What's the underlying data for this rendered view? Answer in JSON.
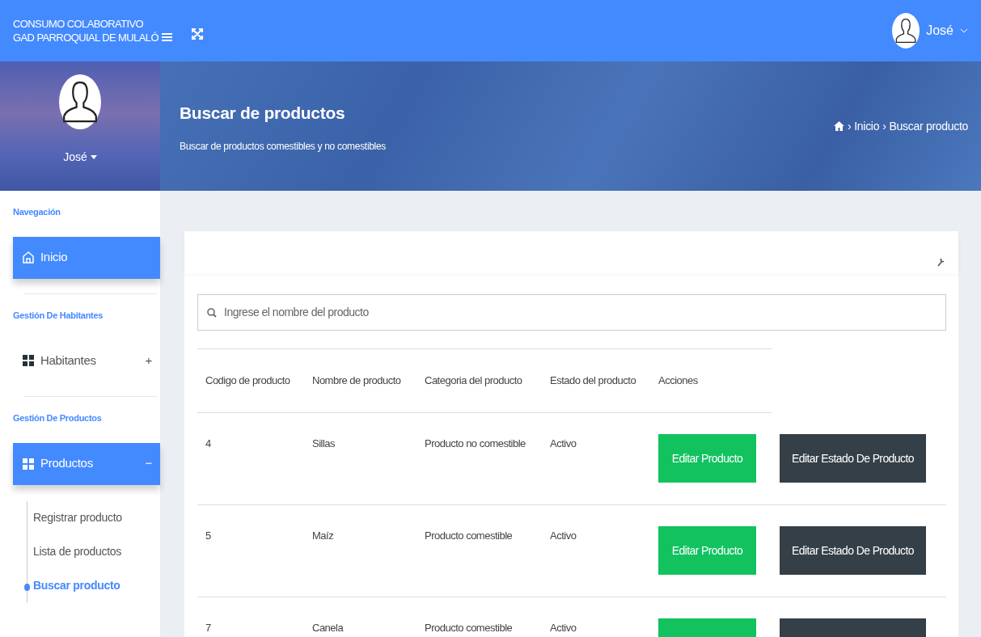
{
  "topbar": {
    "brand_lines": [
      "CONSUMO COLABORATIVO",
      "GAD PARROQUIAL DE MULALÓ"
    ],
    "user": "José"
  },
  "profile": {
    "name": "José"
  },
  "sidebar": {
    "sections": [
      {
        "title": "Navegación",
        "items": [
          {
            "label": "Inicio",
            "kind": "home",
            "selected": true
          }
        ]
      },
      {
        "title": "Gestión De Habitantes",
        "items": [
          {
            "label": "Habitantes",
            "kind": "group",
            "selected": false,
            "expander": "+"
          }
        ]
      },
      {
        "title": "Gestión De Productos",
        "items": [
          {
            "label": "Productos",
            "kind": "group",
            "selected": true,
            "expander": "−",
            "children": [
              {
                "label": "Registrar producto",
                "selected": false
              },
              {
                "label": "Lista de productos",
                "selected": false
              },
              {
                "label": "Buscar producto",
                "selected": true
              }
            ]
          }
        ]
      }
    ]
  },
  "header": {
    "title": "Buscar de productos",
    "subtitle": "Buscar de productos comestibles y no comestibles",
    "breadcrumb": [
      {
        "separator": "›",
        "label": "Inicio"
      },
      {
        "separator": "›",
        "label": "Buscar producto"
      }
    ]
  },
  "search": {
    "placeholder": "Ingrese el nombre del producto"
  },
  "table": {
    "columns": [
      "Codigo de producto",
      "Nombre de producto",
      "Categoria del producto",
      "Estado del producto",
      "Acciones"
    ],
    "rows": [
      {
        "cells": [
          "4",
          "Sillas",
          "Producto no comestible",
          "Activo"
        ],
        "actions": [
          {
            "kind": "edit",
            "label": "Editar Producto"
          },
          {
            "kind": "state",
            "label": "Editar Estado De Producto"
          }
        ]
      },
      {
        "cells": [
          "5",
          "Maíz",
          "Producto comestible",
          "Activo"
        ],
        "actions": [
          {
            "kind": "edit",
            "label": "Editar Producto"
          },
          {
            "kind": "state",
            "label": "Editar Estado De Producto"
          }
        ]
      },
      {
        "cells": [
          "7",
          "Canela",
          "Producto comestible",
          "Activo"
        ],
        "actions": [
          {
            "kind": "edit"
          },
          {
            "kind": "state"
          }
        ]
      }
    ]
  }
}
